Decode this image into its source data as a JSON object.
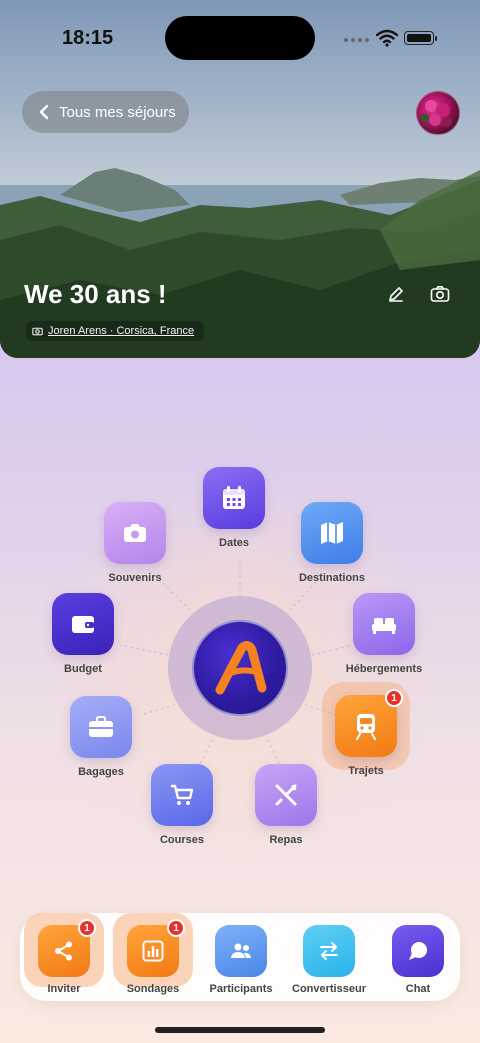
{
  "status_bar": {
    "time": "18:15"
  },
  "header": {
    "back_label": "Tous mes séjours",
    "trip_title": "We 30 ans !",
    "photo_credit": "Joren Arens · Corsica, France"
  },
  "menu": {
    "items": [
      {
        "label": "Dates",
        "icon": "calendar-icon",
        "color": "#6d4ee8"
      },
      {
        "label": "Destinations",
        "icon": "map-icon",
        "color": "#4a8ff0"
      },
      {
        "label": "Hébergements",
        "icon": "bed-icon",
        "color": "#a07ef0"
      },
      {
        "label": "Trajets",
        "icon": "train-icon",
        "color": "#f7871f",
        "badge": "1"
      },
      {
        "label": "Repas",
        "icon": "utensils-icon",
        "color": "#b38cf2"
      },
      {
        "label": "Courses",
        "icon": "cart-icon",
        "color": "#6f7ef0"
      },
      {
        "label": "Bagages",
        "icon": "suitcase-icon",
        "color": "#8c97f2"
      },
      {
        "label": "Budget",
        "icon": "wallet-icon",
        "color": "#4a2fc8"
      },
      {
        "label": "Souvenirs",
        "icon": "camera-icon",
        "color": "#c79bf0"
      }
    ]
  },
  "bottom_bar": {
    "items": [
      {
        "label": "Inviter",
        "icon": "share-icon",
        "color": "#f7871f",
        "badge": "1"
      },
      {
        "label": "Sondages",
        "icon": "poll-icon",
        "color": "#f7871f",
        "badge": "1"
      },
      {
        "label": "Participants",
        "icon": "people-icon",
        "color": "#5c9bf0"
      },
      {
        "label": "Convertisseur",
        "icon": "exchange-icon",
        "color": "#3cc0ee"
      },
      {
        "label": "Chat",
        "icon": "chat-icon",
        "color": "#5b3fd8"
      }
    ]
  }
}
